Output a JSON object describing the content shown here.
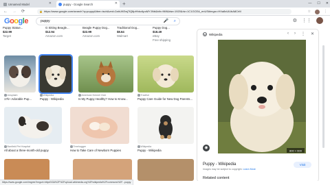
{
  "tabs": [
    {
      "label": "Unnamed Model"
    },
    {
      "label": "puppy - Google Search"
    }
  ],
  "new_tab_symbol": "+",
  "window_controls": {
    "minimize": "—",
    "maximize": "☐",
    "close": "✕"
  },
  "address": {
    "url": "https://www.google.com/search?q=puppy&tbm=isch&ved=2ahUKEwj7lQ8pHhkvApoMYJNb&bih=969&biw=1920&rlz=1C1GCEA_enUS#imgrc=HXa8xUlUbA8CrM"
  },
  "search": {
    "logo_letters": [
      "G",
      "o",
      "o",
      "g",
      "l",
      "e"
    ],
    "query": "puppy"
  },
  "shopping": [
    {
      "title": "Puppy Statue...",
      "price": "$22.99",
      "store": "Target"
    },
    {
      "title": "G Sitting Beagle...",
      "price": "$12.94",
      "store": "Amazon.com"
    },
    {
      "title": "Beagle Puppy Dog...",
      "price": "$22.99",
      "store": "Amazon.com"
    },
    {
      "title": "Traditional Dog...",
      "price": "$8.64",
      "store": "Walmart"
    },
    {
      "title": "Puppy Dog...",
      "price": "$18.49",
      "store": "eBay",
      "note": "Free shipping"
    }
  ],
  "results_row1": [
    {
      "source": "Unsplash",
      "caption": "17k+ Adorable Pup..."
    },
    {
      "source": "Wikipedia",
      "caption": "Puppy - Wikipedia"
    },
    {
      "source": "American Kennel Club",
      "caption": "Is My Puppy Healthy? How to Know..."
    },
    {
      "source": "Tractive",
      "caption": "Puppy Care Guide for New Dog Parents..."
    }
  ],
  "results_row2": [
    {
      "source": "Banfield Pet Hospital",
      "caption": "All about a three-month-old puppy"
    },
    {
      "source": "Treehugger",
      "caption": "How to Take Care of Newborn Puppies"
    },
    {
      "source": "Wikipedia",
      "caption": "Puppy - Wikipedia"
    }
  ],
  "panel": {
    "source": "Wikipedia",
    "title": "Puppy - Wikipedia",
    "visit_label": "Visit",
    "note_prefix": "Images may be subject to copyright.",
    "note_link": "Learn More",
    "related": "Related content",
    "image_size": "800 × 600"
  },
  "status_url": "https://www.google.com/imgres?imgurl=https%3A%2F%2Fupload.wikimedia.org%2Fwikipedia%2Fcommons%2F...puppy",
  "icons": {
    "back": "←",
    "forward": "→",
    "reload": "⟳",
    "lock": "🔒",
    "star": "☆",
    "menu": "⋮",
    "mic": "🎤",
    "search": "⌕",
    "settings": "⚙",
    "apps": "⋮⋮",
    "prev": "‹",
    "next": "›",
    "more": "⋮",
    "close": "✕",
    "lens": "◉"
  },
  "colors": {
    "google_blue": "#4285f4",
    "link_blue": "#1a73e8",
    "tabbar": "#dee1e6"
  }
}
